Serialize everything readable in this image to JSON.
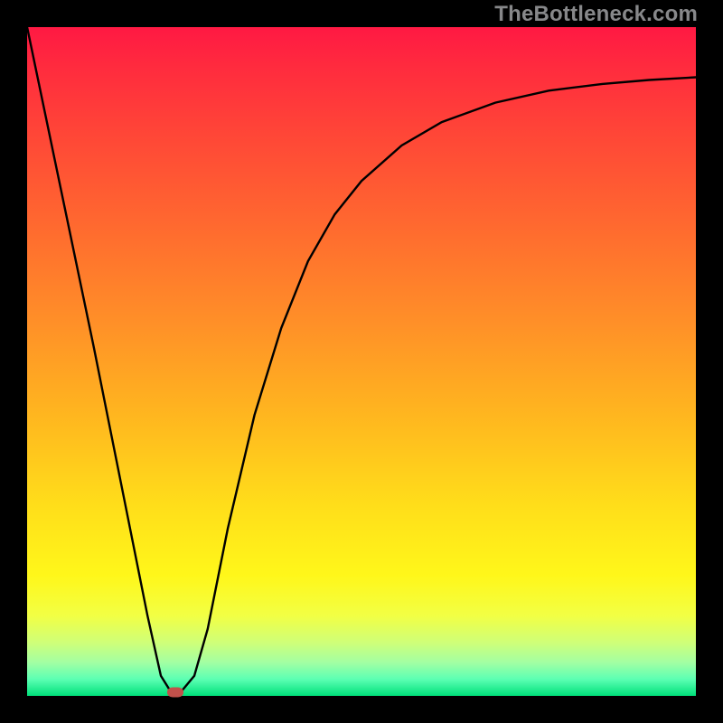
{
  "watermark": "TheBottleneck.com",
  "chart_data": {
    "type": "line",
    "title": "",
    "xlabel": "",
    "ylabel": "",
    "xlim": [
      0,
      1
    ],
    "ylim": [
      0,
      1
    ],
    "grid": false,
    "legend": false,
    "background": {
      "type": "vertical-gradient",
      "stops": [
        {
          "pos": 0.0,
          "color": "#ff1943"
        },
        {
          "pos": 0.16,
          "color": "#ff4637"
        },
        {
          "pos": 0.44,
          "color": "#ff8f28"
        },
        {
          "pos": 0.72,
          "color": "#ffdf1a"
        },
        {
          "pos": 0.88,
          "color": "#f2ff44"
        },
        {
          "pos": 0.95,
          "color": "#a3ffa3"
        },
        {
          "pos": 1.0,
          "color": "#00e07a"
        }
      ]
    },
    "series": [
      {
        "name": "bottleneck-curve",
        "stroke": "#000000",
        "x": [
          0.0,
          0.05,
          0.1,
          0.15,
          0.18,
          0.2,
          0.215,
          0.23,
          0.25,
          0.27,
          0.3,
          0.34,
          0.38,
          0.42,
          0.46,
          0.5,
          0.56,
          0.62,
          0.7,
          0.78,
          0.86,
          0.93,
          1.0
        ],
        "y": [
          1.0,
          0.76,
          0.52,
          0.27,
          0.12,
          0.03,
          0.006,
          0.006,
          0.03,
          0.1,
          0.25,
          0.42,
          0.55,
          0.65,
          0.72,
          0.77,
          0.823,
          0.858,
          0.887,
          0.905,
          0.915,
          0.921,
          0.925
        ]
      }
    ],
    "marker": {
      "name": "minimum-point",
      "x": 0.222,
      "y": 0.006,
      "color": "#c1514b",
      "shape": "rounded-rect"
    }
  }
}
